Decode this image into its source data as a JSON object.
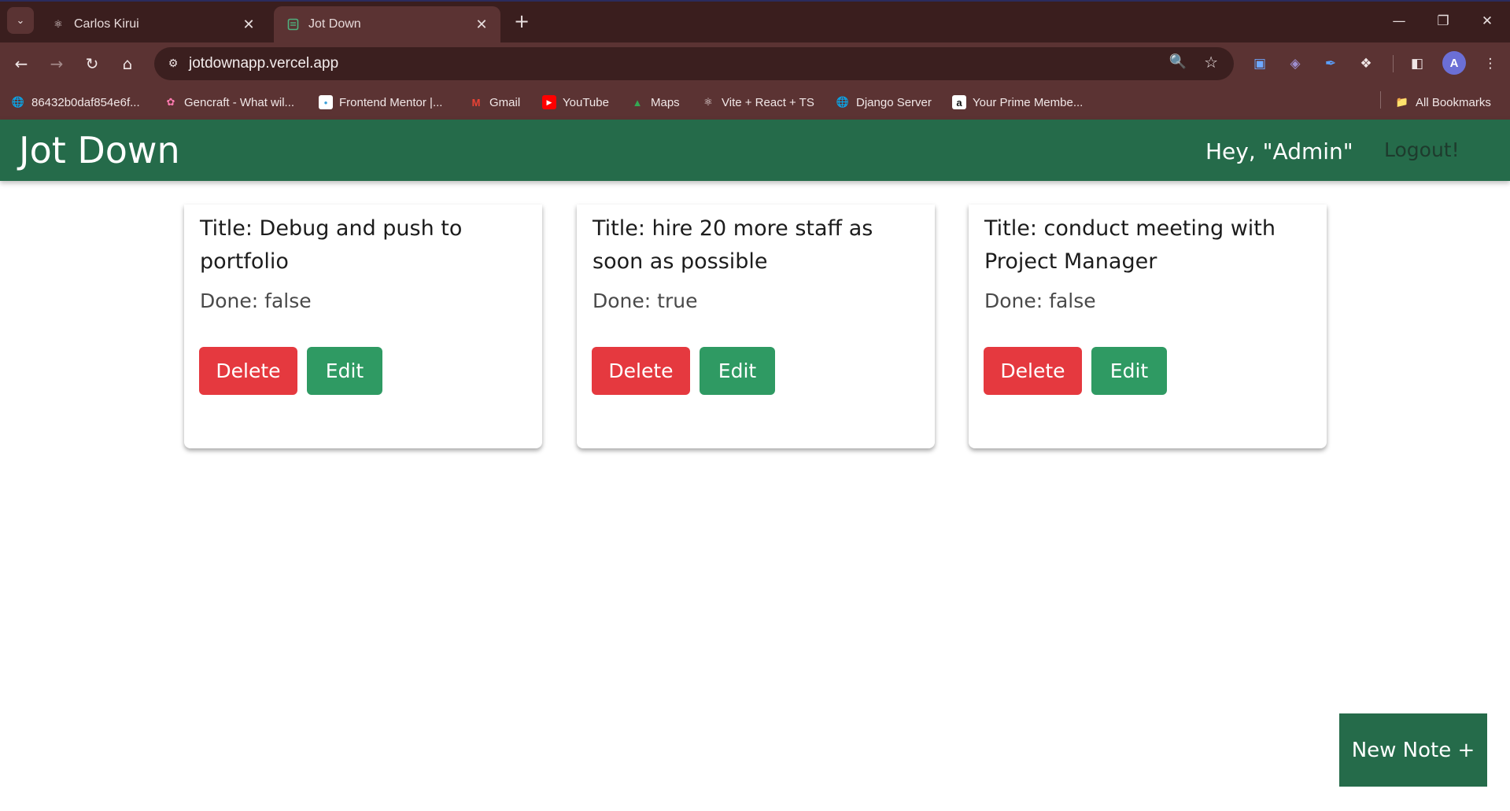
{
  "browser": {
    "tabs": [
      {
        "title": "Carlos Kirui",
        "icon": "react-icon",
        "active": false
      },
      {
        "title": "Jot Down",
        "icon": "notepad-icon",
        "active": true
      }
    ],
    "url": "jotdownapp.vercel.app",
    "bookmarks": [
      {
        "label": "86432b0daf854e6f...",
        "icon": "globe-icon"
      },
      {
        "label": "Gencraft - What wil...",
        "icon": "octopus-icon"
      },
      {
        "label": "Frontend Mentor |...",
        "icon": "frontend-mentor-icon"
      },
      {
        "label": "Gmail",
        "icon": "gmail-icon"
      },
      {
        "label": "YouTube",
        "icon": "youtube-icon"
      },
      {
        "label": "Maps",
        "icon": "maps-icon"
      },
      {
        "label": "Vite + React + TS",
        "icon": "react-icon"
      },
      {
        "label": "Django Server",
        "icon": "globe-icon"
      },
      {
        "label": "Your Prime Membe...",
        "icon": "amazon-icon"
      }
    ],
    "all_bookmarks": "All Bookmarks",
    "profile_initial": "A"
  },
  "app": {
    "brand": "Jot Down",
    "greeting": "Hey, \"Admin\"",
    "logout": "Logout!",
    "notes": [
      {
        "title": "Title: Debug and push to portfolio",
        "done": "Done: false"
      },
      {
        "title": "Title: hire 20 more staff as soon as possible",
        "done": "Done: true"
      },
      {
        "title": "Title: conduct meeting with Project Manager",
        "done": "Done: false"
      }
    ],
    "delete_label": "Delete",
    "edit_label": "Edit",
    "new_note_label": "New Note +",
    "colors": {
      "header": "#256b4a",
      "delete": "#e5393f",
      "edit": "#2f9a63"
    }
  }
}
